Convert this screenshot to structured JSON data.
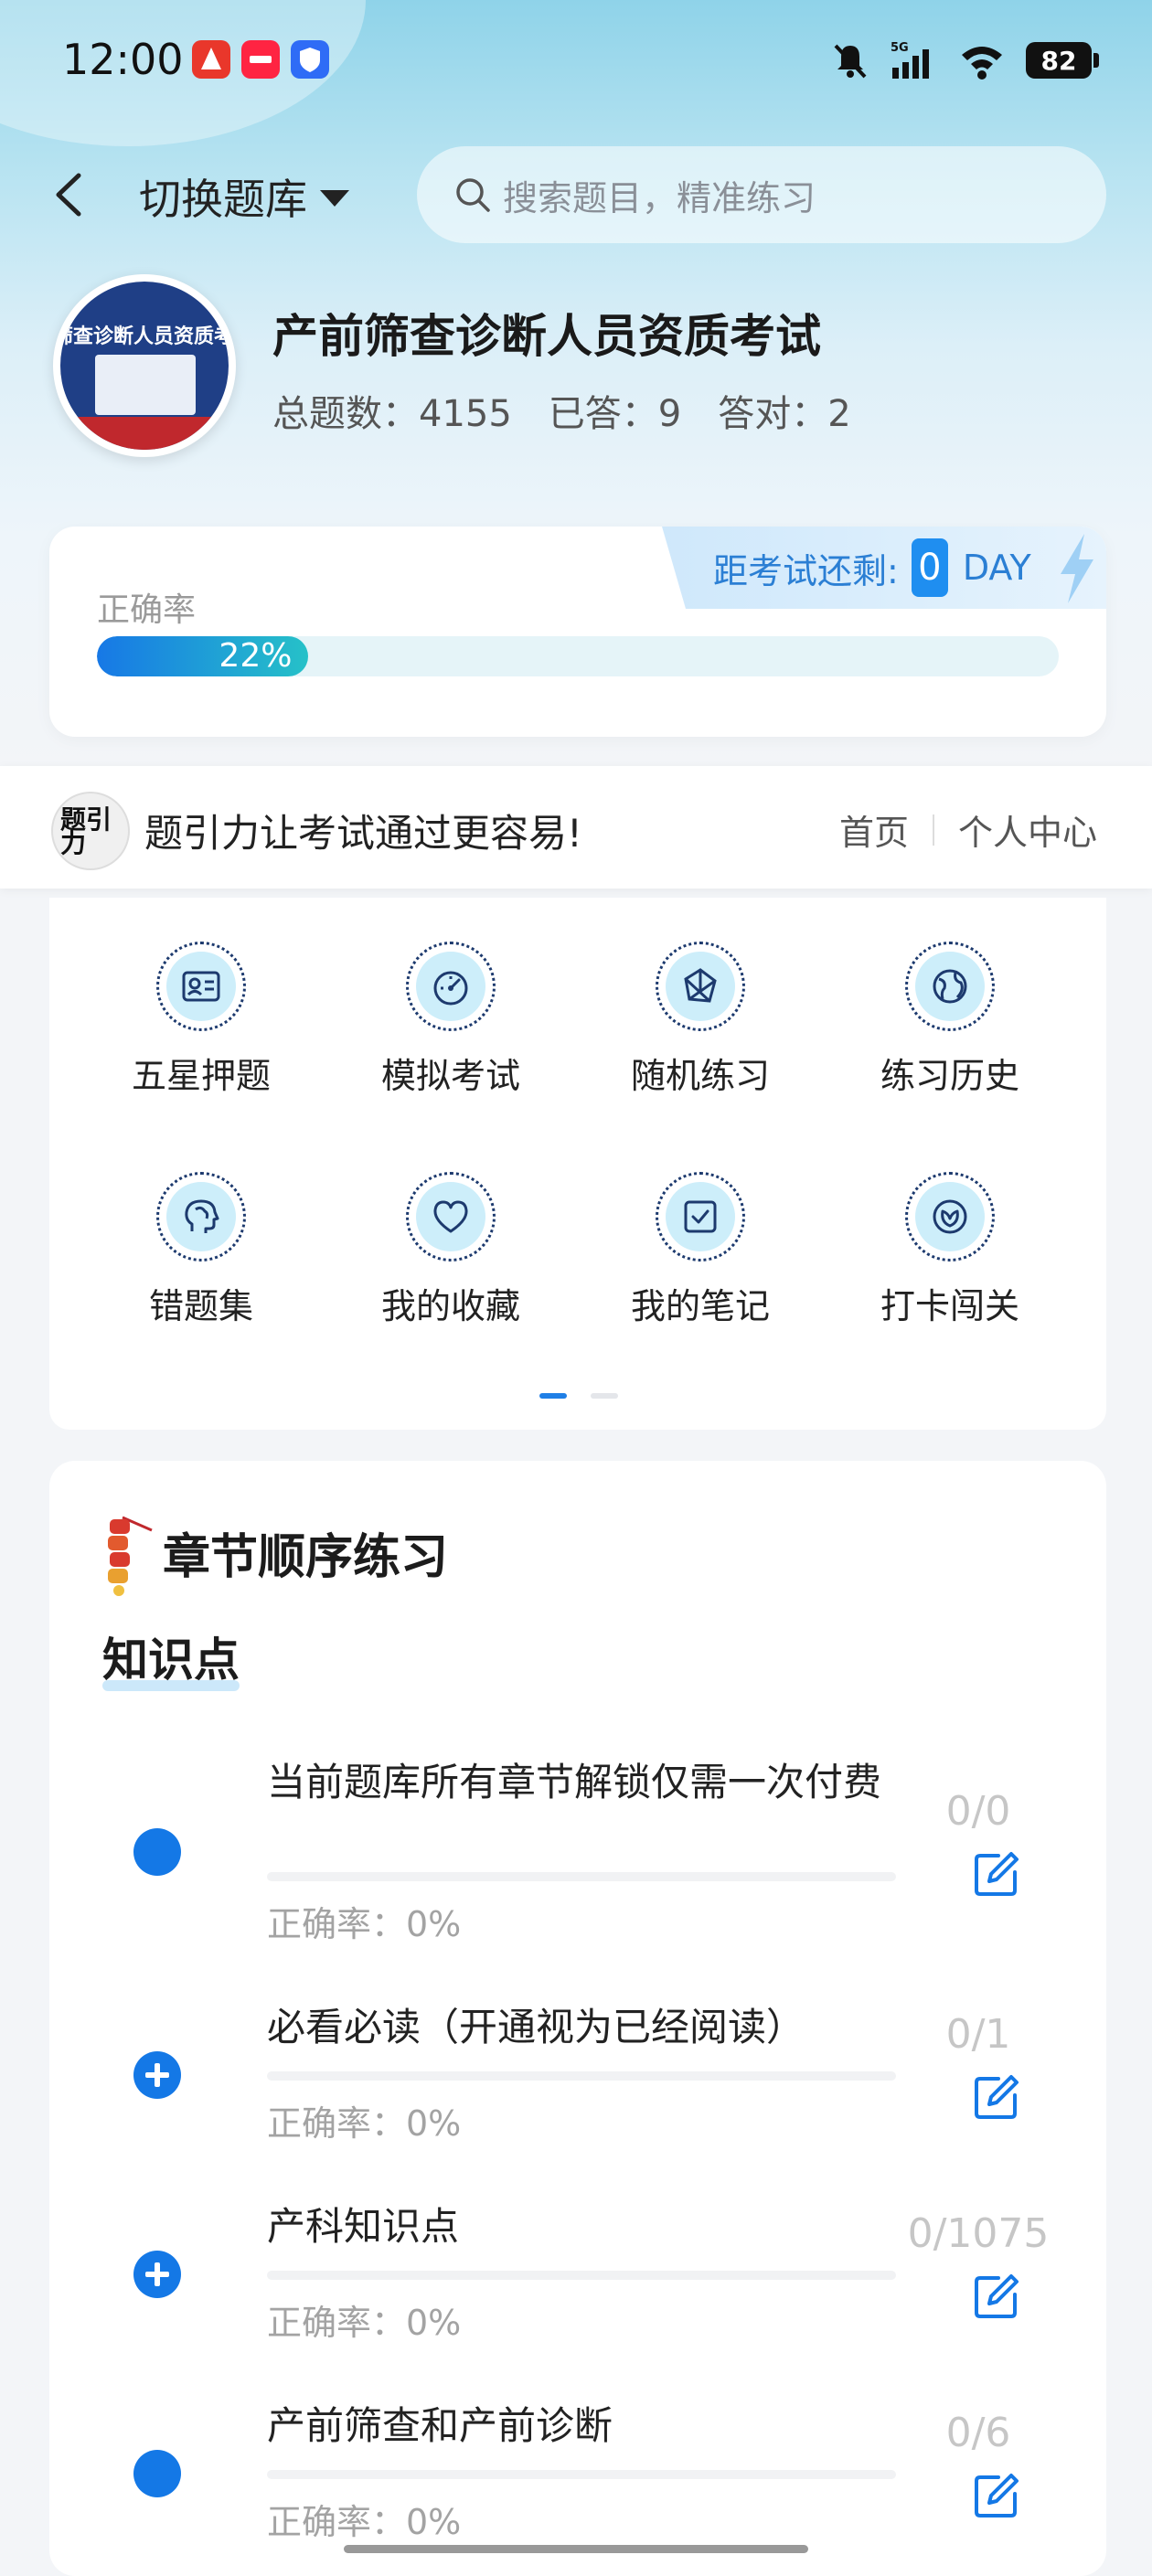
{
  "status_bar": {
    "time": "12:00",
    "battery": "82",
    "network": "5G"
  },
  "header": {
    "back_icon": "chevron-left-icon",
    "switch_label": "切换题库",
    "search_placeholder": "搜索题目，精准练习"
  },
  "profile": {
    "avatar_text": "筛查诊断人员资质考",
    "title": "产前筛查诊断人员资质考试",
    "total_label": "总题数：4155",
    "answered_label": "已答：9",
    "correct_label": "答对：2"
  },
  "accuracy": {
    "label": "正确率",
    "value_text": "22%",
    "value": 0.22,
    "countdown_label": "距考试还剩:",
    "countdown_days": "0",
    "countdown_unit": "DAY"
  },
  "slogan": {
    "logo_text": "题引力",
    "text": "题引力让考试通过更容易!",
    "nav_home": "首页",
    "nav_profile": "个人中心"
  },
  "menu": {
    "items": [
      {
        "label": "五星押题",
        "icon": "id-card-icon"
      },
      {
        "label": "模拟考试",
        "icon": "gauge-icon"
      },
      {
        "label": "随机练习",
        "icon": "random-icon"
      },
      {
        "label": "练习历史",
        "icon": "globe-icon"
      },
      {
        "label": "错题集",
        "icon": "brain-icon"
      },
      {
        "label": "我的收藏",
        "icon": "heart-icon"
      },
      {
        "label": "我的笔记",
        "icon": "check-note-icon"
      },
      {
        "label": "打卡闯关",
        "icon": "leaf-icon"
      }
    ],
    "page": 1,
    "pages": 2
  },
  "chapters": {
    "title": "章节顺序练习",
    "section": "知识点",
    "items": [
      {
        "name": "当前题库所有章节解锁仅需一次付费",
        "rate": "正确率：0%",
        "count": "0/0",
        "bullet": "dot"
      },
      {
        "name": "必看必读（开通视为已经阅读）",
        "rate": "正确率：0%",
        "count": "0/1",
        "bullet": "plus"
      },
      {
        "name": "产科知识点",
        "rate": "正确率：0%",
        "count": "0/1075",
        "bullet": "plus"
      },
      {
        "name": "产前筛查和产前诊断",
        "rate": "正确率：0%",
        "count": "0/6",
        "bullet": "dot"
      }
    ]
  },
  "colors": {
    "accent": "#1478e6",
    "bar_start": "#1778e6",
    "bar_end": "#26c1c8"
  }
}
